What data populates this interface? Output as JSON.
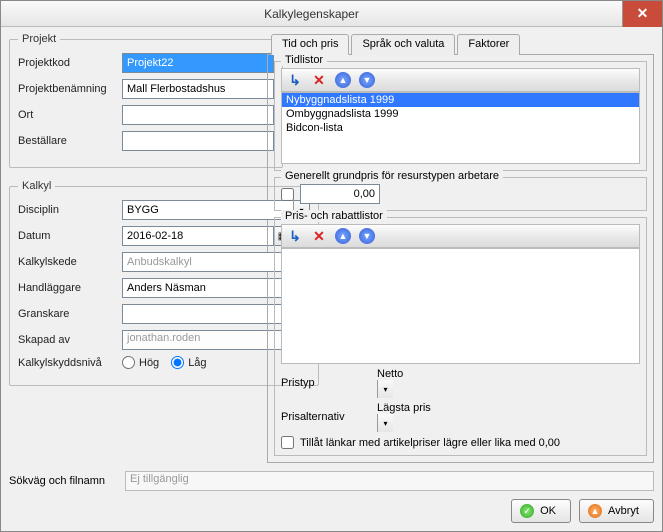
{
  "window": {
    "title": "Kalkylegenskaper"
  },
  "projekt": {
    "legend": "Projekt",
    "rows": {
      "projektkod": {
        "label": "Projektkod",
        "value": "Projekt22"
      },
      "projektbenamning": {
        "label": "Projektbenämning",
        "value": "Mall Flerbostadshus"
      },
      "ort": {
        "label": "Ort",
        "value": ""
      },
      "bestallare": {
        "label": "Beställare",
        "value": ""
      }
    }
  },
  "kalkyl": {
    "legend": "Kalkyl",
    "rows": {
      "disciplin": {
        "label": "Disciplin",
        "value": "BYGG"
      },
      "datum": {
        "label": "Datum",
        "value": "2016-02-18"
      },
      "kalkylskede": {
        "label": "Kalkylskede",
        "value": "Anbudskalkyl"
      },
      "handlaggare": {
        "label": "Handläggare",
        "value": "Anders Näsman"
      },
      "granskare": {
        "label": "Granskare",
        "value": ""
      },
      "skapad_av": {
        "label": "Skapad av",
        "value": "jonathan.roden"
      },
      "skyddsniva": {
        "label": "Kalkylskyddsnivå",
        "hog": "Hög",
        "lag": "Låg",
        "selected": "lag"
      }
    }
  },
  "tabs": {
    "tid_och_pris": "Tid och pris",
    "sprak_och_valuta": "Språk och valuta",
    "faktorer": "Faktorer"
  },
  "tidlistor": {
    "label": "Tidlistor",
    "items": [
      "Nybyggnadslista 1999",
      "Ombyggnadslista 1999",
      "Bidcon-lista"
    ],
    "selected": 0
  },
  "grundpris": {
    "label": "Generellt grundpris för resurstypen arbetare",
    "checked": false,
    "value": "0,00"
  },
  "prislistor": {
    "label": "Pris- och rabattlistor",
    "items": []
  },
  "pristyp": {
    "label": "Pristyp",
    "value": "Netto"
  },
  "prisalternativ": {
    "label": "Prisalternativ",
    "value": "Lägsta pris"
  },
  "tillat_lankar": {
    "label": "Tillåt länkar med artikelpriser lägre eller lika med 0,00",
    "checked": false
  },
  "sokvag": {
    "label": "Sökväg och filnamn",
    "value": "Ej tillgänglig"
  },
  "buttons": {
    "ok": "OK",
    "avbryt": "Avbryt"
  },
  "icons": {
    "chevron_down": "▾",
    "calendar": "▦",
    "arrow_in": "↳",
    "x": "✕",
    "up": "▲",
    "down": "▼",
    "check": "✓"
  }
}
